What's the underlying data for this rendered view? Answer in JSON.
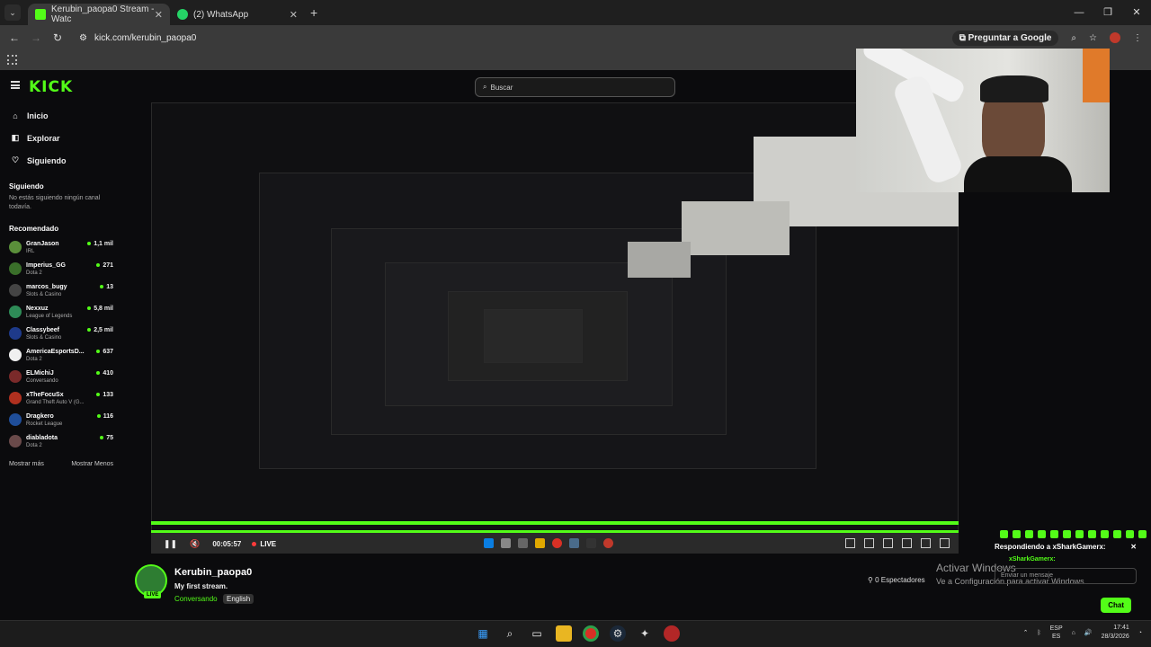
{
  "browser": {
    "tabs": [
      {
        "label": "Kerubin_paopa0 Stream - Watc",
        "active": true
      },
      {
        "label": "(2) WhatsApp",
        "active": false
      }
    ],
    "url": "kick.com/kerubin_paopa0",
    "google_button": "Preguntar a Google"
  },
  "header": {
    "logo": "KICK",
    "search_placeholder": "Buscar"
  },
  "sidebar": {
    "nav": [
      {
        "label": "Inicio",
        "icon": "home-icon"
      },
      {
        "label": "Explorar",
        "icon": "compass-icon"
      },
      {
        "label": "Siguiendo",
        "icon": "heart-icon"
      }
    ],
    "following_title": "Siguiendo",
    "following_empty": "No estás siguiendo ningún canal todavía.",
    "recommended_title": "Recomendado",
    "recommended": [
      {
        "name": "GranJason",
        "category": "IRL",
        "viewers": "1,1 mil",
        "color": "#5a8f3a"
      },
      {
        "name": "Imperius_GG",
        "category": "Dota 2",
        "viewers": "271",
        "color": "#3a6f2a"
      },
      {
        "name": "marcos_bugy",
        "category": "Slots & Casino",
        "viewers": "13",
        "color": "#444"
      },
      {
        "name": "Nexxuz",
        "category": "League of Legends",
        "viewers": "5,8 mil",
        "color": "#2e8b57"
      },
      {
        "name": "Classybeef",
        "category": "Slots & Casino",
        "viewers": "2,5 mil",
        "color": "#1e3a8a"
      },
      {
        "name": "AmericaEsportsD...",
        "category": "Dota 2",
        "viewers": "637",
        "color": "#f0f0f0"
      },
      {
        "name": "ELMichiJ",
        "category": "Conversando",
        "viewers": "410",
        "color": "#7a2a2a"
      },
      {
        "name": "xTheFocuSx",
        "category": "Grand Theft Auto V (G...",
        "viewers": "133",
        "color": "#b0301f"
      },
      {
        "name": "Dragkero",
        "category": "Rocket League",
        "viewers": "116",
        "color": "#1f4e9a"
      },
      {
        "name": "diabladota",
        "category": "Dota 2",
        "viewers": "75",
        "color": "#6a4a4a"
      }
    ],
    "show_more": "Mostrar más",
    "show_less": "Mostrar Menos"
  },
  "player": {
    "time": "00:05:57",
    "live": "LIVE",
    "progress": 1.0
  },
  "stream": {
    "streamer": "Kerubin_paopa0",
    "title": "My first stream.",
    "category": "Conversando",
    "language": "English",
    "live_badge": "LIVE",
    "viewers": "0 Espectadores"
  },
  "chat": {
    "reply_label": "Respondiendo a xSharkGamerx:",
    "reply_to": "xSharkGamerx:",
    "input_placeholder": "Enviar un mensaje",
    "send_button": "Chat"
  },
  "windows": {
    "activate_title": "Activar Windows",
    "activate_sub": "Ve a Configuración para activar Windows.",
    "lang_top": "ESP",
    "lang_bottom": "ES",
    "time": "17:41",
    "date": "28/3/2026"
  }
}
